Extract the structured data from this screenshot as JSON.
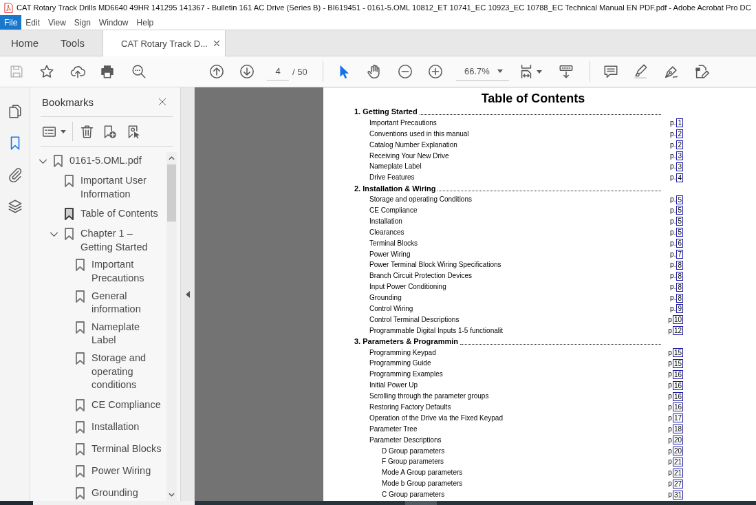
{
  "window": {
    "title": "CAT Rotary Track Drills MD6640 49HR 141295 141367 - Bulletin 161 AC Drive (Series B) - BI619451 - 0161-5.OML 10812_ET 10741_EC 10923_EC 10788_EC Technical Manual EN PDF.pdf - Adobe Acrobat Pro DC"
  },
  "menu_bar": [
    {
      "label": "File",
      "selected": true
    },
    {
      "label": "Edit",
      "selected": false
    },
    {
      "label": "View",
      "selected": false
    },
    {
      "label": "Sign",
      "selected": false
    },
    {
      "label": "Window",
      "selected": false
    },
    {
      "label": "Help",
      "selected": false
    }
  ],
  "tabs": [
    {
      "kind": "nav",
      "label": "Home",
      "selected": false
    },
    {
      "kind": "nav",
      "label": "Tools",
      "selected": false
    },
    {
      "kind": "document",
      "label": "CAT Rotary Track D...",
      "selected": true
    }
  ],
  "toolbar": {
    "save": {
      "disabled": true
    },
    "page_number": "4",
    "page_total": "/ 50",
    "tools": [
      {
        "kind": "select",
        "selected": true
      },
      {
        "kind": "hand",
        "selected": false
      }
    ],
    "zoom": "66.7%"
  },
  "side_rail": [
    {
      "kind": "pages",
      "selected": false
    },
    {
      "kind": "bookmarks",
      "selected": true
    },
    {
      "kind": "attachments",
      "selected": false
    },
    {
      "kind": "layers",
      "selected": false
    }
  ],
  "bookmarks_panel": {
    "title": "Bookmarks",
    "tree": [
      {
        "label": "0161-5.OML.pdf",
        "current": false,
        "expanded": true,
        "children": [
          {
            "label": "Important User Information",
            "current": false
          },
          {
            "label": "Table of Contents",
            "current": true
          },
          {
            "label": "Chapter 1 – Getting Started",
            "current": false,
            "expanded": true,
            "children": [
              {
                "label": "Important Precautions",
                "current": false
              },
              {
                "label": "General information",
                "current": false
              },
              {
                "label": "Nameplate Label",
                "current": false
              },
              {
                "label": "Storage and operating conditions",
                "current": false
              },
              {
                "label": "CE Compliance",
                "current": false
              },
              {
                "label": "Installation",
                "current": false
              },
              {
                "label": "Terminal Blocks",
                "current": false
              },
              {
                "label": "Power Wiring",
                "current": false
              },
              {
                "label": "Grounding",
                "current": false
              }
            ]
          }
        ]
      }
    ]
  },
  "document_page": {
    "title": "Table of Contents",
    "sections": [
      {
        "heading": "1. Getting Started",
        "entries": [
          {
            "title": "Important Precautions",
            "prefix": "p.",
            "page": "1"
          },
          {
            "title": "Conventions used in this manual",
            "prefix": "p.",
            "page": "2"
          },
          {
            "title": "Catalog Number Explanation",
            "prefix": "p.",
            "page": "2"
          },
          {
            "title": "Receiving Your New Drive",
            "prefix": "p.",
            "page": "3"
          },
          {
            "title": "Nameplate Label",
            "prefix": "p.",
            "page": "3"
          },
          {
            "title": "Drive Features",
            "prefix": "p.",
            "page": "4"
          }
        ]
      },
      {
        "heading": "2. Installation & Wiring",
        "entries": [
          {
            "title": "Storage and operating Conditions",
            "prefix": "p.",
            "page": "5"
          },
          {
            "title": "CE Compliance",
            "prefix": "p.",
            "page": "5"
          },
          {
            "title": "Installation",
            "prefix": "p.",
            "page": "5"
          },
          {
            "title": "Clearances",
            "prefix": "p.",
            "page": "5"
          },
          {
            "title": "Terminal Blocks",
            "prefix": "p.",
            "page": "6"
          },
          {
            "title": "Power Wiring",
            "prefix": "p.",
            "page": "7"
          },
          {
            "title": "Power Terminal Block Wiring Specifications",
            "prefix": "p.",
            "page": "8"
          },
          {
            "title": "Branch Circuit Protection Devices",
            "prefix": "p.",
            "page": "8"
          },
          {
            "title": "Input Power Conditioning",
            "prefix": "p.",
            "page": "8"
          },
          {
            "title": "Grounding",
            "prefix": "p.",
            "page": "8"
          },
          {
            "title": "Control Wiring",
            "prefix": "p.",
            "page": "9"
          },
          {
            "title": "Control Terminal Descriptions",
            "prefix": "p",
            "page": "10"
          },
          {
            "title": "Programmable Digital Inputs 1-5 functionalit",
            "prefix": "p",
            "page": "12"
          }
        ]
      },
      {
        "heading": "3. Parameters & Programmin",
        "entries": [
          {
            "title": "Programming Keypad",
            "prefix": "p",
            "page": "15"
          },
          {
            "title": "Programming Guide",
            "prefix": "p",
            "page": "15"
          },
          {
            "title": "Programming Examples",
            "prefix": "p",
            "page": "16"
          },
          {
            "title": "Initial Power Up",
            "prefix": "p",
            "page": "16"
          },
          {
            "title": "Scrolling through the parameter groups",
            "prefix": "p",
            "page": "16"
          },
          {
            "title": "Restoring Factory Defaults",
            "prefix": "p",
            "page": "16"
          },
          {
            "title": "Operation of the Drive via the Fixed Keypad",
            "prefix": "p",
            "page": "17"
          },
          {
            "title": "Parameter Tree",
            "prefix": "p",
            "page": "18"
          },
          {
            "title": "Parameter Descriptions",
            "prefix": "p",
            "page": "20",
            "children": [
              {
                "title": "D Group parameters",
                "prefix": "p",
                "page": "20"
              },
              {
                "title": "F Group parameters",
                "prefix": "p",
                "page": "21"
              },
              {
                "title": "Mode A Group parameters",
                "prefix": "p",
                "page": "21"
              },
              {
                "title": "Mode b Group parameters",
                "prefix": "p",
                "page": "27"
              },
              {
                "title": "C Group parameters",
                "prefix": "p",
                "page": "31"
              }
            ]
          }
        ]
      }
    ]
  }
}
